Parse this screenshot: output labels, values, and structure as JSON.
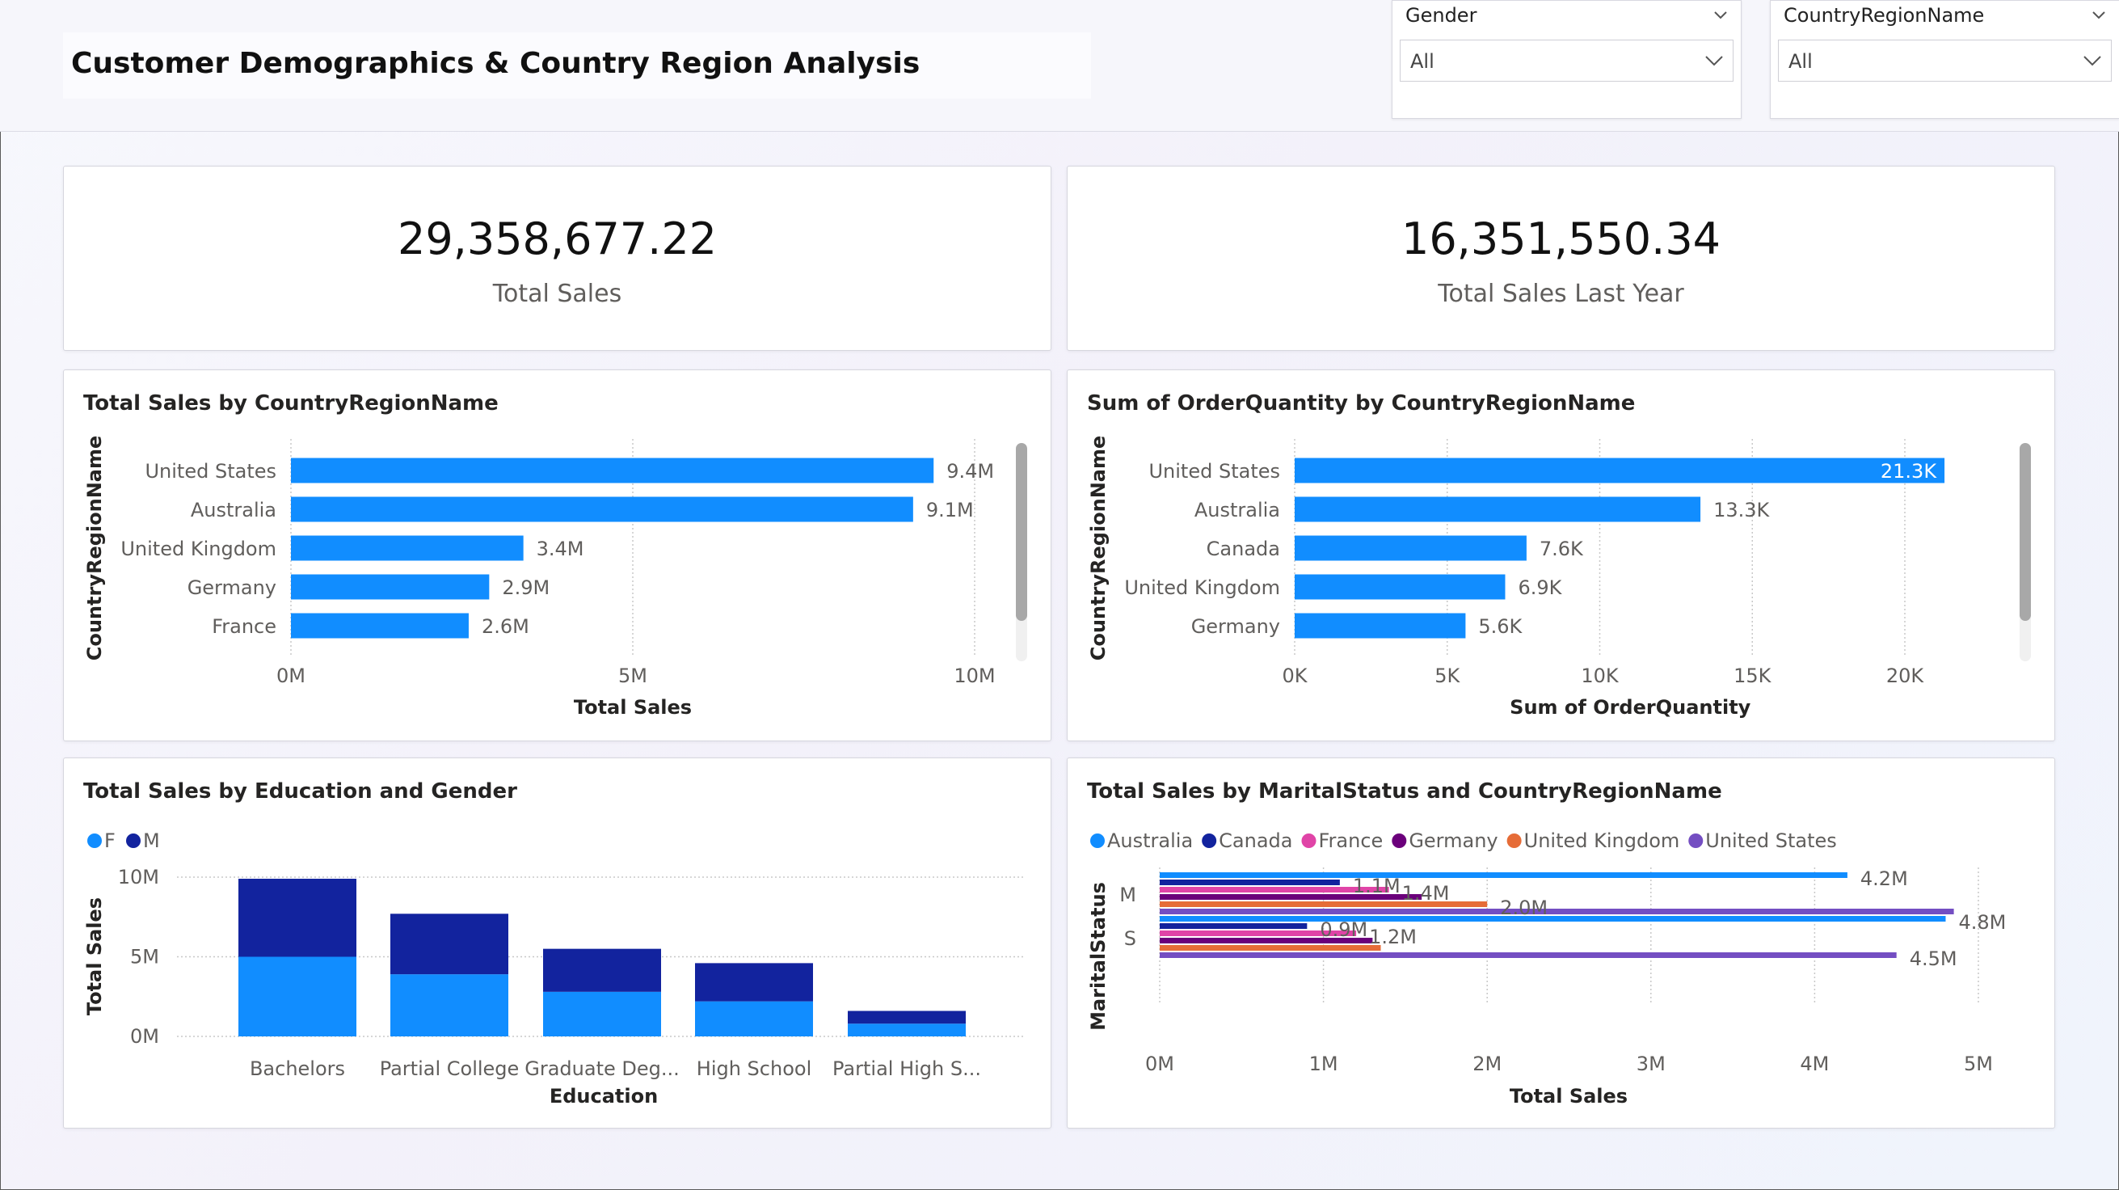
{
  "page": {
    "title": "Customer Demographics & Country Region Analysis"
  },
  "slicers": [
    {
      "label": "Gender",
      "value": "All"
    },
    {
      "label": "CountryRegionName",
      "value": "All"
    }
  ],
  "kpis": [
    {
      "value": "29,358,677.22",
      "label": "Total Sales"
    },
    {
      "value": "16,351,550.34",
      "label": "Total Sales Last Year"
    }
  ],
  "colors": {
    "bar": "#118DFF",
    "dark": "#12239E",
    "grid": "#c8c8c8",
    "axis": "#605e5c"
  },
  "chart_data": [
    {
      "type": "bar",
      "orientation": "horizontal",
      "title": "Total Sales by CountryRegionName",
      "xlabel": "Total Sales",
      "ylabel": "CountryRegionName",
      "categories": [
        "United States",
        "Australia",
        "United Kingdom",
        "Germany",
        "France"
      ],
      "values": [
        9.4,
        9.1,
        3.4,
        2.9,
        2.6
      ],
      "data_labels": [
        "9.4M",
        "9.1M",
        "3.4M",
        "2.9M",
        "2.6M"
      ],
      "xticks": [
        0,
        5,
        10
      ],
      "xtick_labels": [
        "0M",
        "5M",
        "10M"
      ],
      "xlim": [
        0,
        10
      ],
      "unit": "M"
    },
    {
      "type": "bar",
      "orientation": "horizontal",
      "title": "Sum of OrderQuantity by CountryRegionName",
      "xlabel": "Sum of OrderQuantity",
      "ylabel": "CountryRegionName",
      "categories": [
        "United States",
        "Australia",
        "Canada",
        "United Kingdom",
        "Germany"
      ],
      "values": [
        21.3,
        13.3,
        7.6,
        6.9,
        5.6
      ],
      "data_labels": [
        "21.3K",
        "13.3K",
        "7.6K",
        "6.9K",
        "5.6K"
      ],
      "xticks": [
        0,
        5,
        10,
        15,
        20
      ],
      "xtick_labels": [
        "0K",
        "5K",
        "10K",
        "15K",
        "20K"
      ],
      "xlim": [
        0,
        22
      ],
      "unit": "K"
    },
    {
      "type": "bar",
      "stacked": true,
      "title": "Total Sales by Education and Gender",
      "xlabel": "Education",
      "ylabel": "Total Sales",
      "categories": [
        "Bachelors",
        "Partial College",
        "Graduate Deg...",
        "High School",
        "Partial High S..."
      ],
      "series": [
        {
          "name": "F",
          "color": "#118DFF",
          "values": [
            5.0,
            3.9,
            2.8,
            2.2,
            0.8
          ]
        },
        {
          "name": "M",
          "color": "#12239E",
          "values": [
            4.9,
            3.8,
            2.7,
            2.4,
            0.8
          ]
        }
      ],
      "yticks": [
        0,
        5,
        10
      ],
      "ytick_labels": [
        "0M",
        "5M",
        "10M"
      ],
      "ylim": [
        0,
        10
      ],
      "legend": "top-left"
    },
    {
      "type": "bar",
      "orientation": "horizontal",
      "grouped": true,
      "title": "Total Sales by MaritalStatus and CountryRegionName",
      "xlabel": "Total Sales",
      "ylabel": "MaritalStatus",
      "categories": [
        "M",
        "S"
      ],
      "series": [
        {
          "name": "Australia",
          "color": "#118DFF",
          "values": [
            4.2,
            4.8
          ]
        },
        {
          "name": "Canada",
          "color": "#12239E",
          "values": [
            1.1,
            0.9
          ]
        },
        {
          "name": "France",
          "color": "#E044A7",
          "values": [
            1.4,
            1.2
          ]
        },
        {
          "name": "Germany",
          "color": "#6B007B",
          "values": [
            1.6,
            1.3
          ]
        },
        {
          "name": "United Kingdom",
          "color": "#E66C37",
          "values": [
            2.0,
            1.35
          ]
        },
        {
          "name": "United States",
          "color": "#744EC2",
          "values": [
            4.85,
            4.5
          ]
        }
      ],
      "data_labels": {
        "M": [
          "4.2M",
          "1.1M",
          "1.4M",
          "2.0M"
        ],
        "S": [
          "4.8M",
          "0.9M",
          "1.2M",
          "4.5M"
        ]
      },
      "xticks": [
        0,
        1,
        2,
        3,
        4,
        5
      ],
      "xtick_labels": [
        "0M",
        "1M",
        "2M",
        "3M",
        "4M",
        "5M"
      ],
      "xlim": [
        0,
        5
      ],
      "legend": "top-left"
    }
  ]
}
